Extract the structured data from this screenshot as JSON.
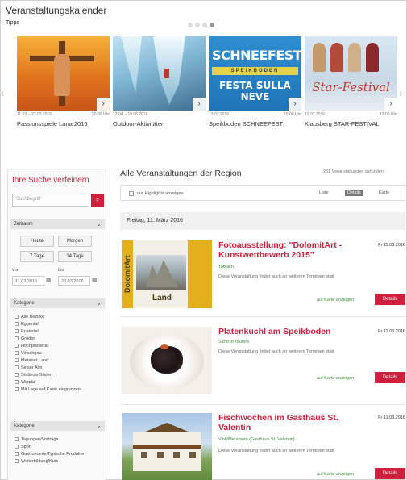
{
  "header": {
    "title": "Veranstaltungskalender",
    "tips_label": "Tipps"
  },
  "carousel": {
    "slides": [
      {
        "start": "11.03. - 23.03.2016",
        "end": "20:30 Uhr",
        "name": "Passionsspiele Lana 2016"
      },
      {
        "start": "12.04. - 18.06.2016",
        "end": "",
        "name": "Outdoor-Aktivitäten"
      },
      {
        "start": "13.03.2016",
        "end": "10:00 Uhr",
        "name": "Speikboden SCHNEEFEST",
        "art_title": "SCHNEEFEST",
        "art_subtitle": "SPEIKBODEN",
        "art_bottom": "FESTA SULLA NEVE"
      },
      {
        "start": "13.03.2016",
        "end": "12:00 Uhr",
        "name": "Klausberg STAR-FESTIVAL",
        "art_title": "Star-Festival"
      }
    ]
  },
  "sidebar": {
    "title": "Ihre Suche verfeinern",
    "search_placeholder": "Suchbegriff",
    "period_label": "Zeitraum",
    "buttons": [
      "Heute",
      "Morgen",
      "7 Tage",
      "14 Tage"
    ],
    "from_label": "von",
    "to_label": "bis",
    "from_value": "11.03.2016",
    "to_value": "25.03.2016",
    "categories_label": "Kategorie",
    "categories": [
      "Alle Bezirke",
      "Eggental",
      "Pustertal",
      "Gröden",
      "Hochpustertal",
      "Vinschgau",
      "Meraner Land",
      "Seiser Alm",
      "Südtirols Süden",
      "Wipptal",
      "Mit Lage auf Karte eingrenzen"
    ],
    "type_label": "Kategorie",
    "types": [
      "Tagungen/Vorträge",
      "Sport",
      "Gastronomie/Typische Produkte",
      "Weiterbildung/Kurs"
    ]
  },
  "main": {
    "title": "Alle Veranstaltungen der Region",
    "result_count": "281 Veranstaltungen gefunden",
    "highlight_label": "nur Highlights anzeigen",
    "view_list": "Liste",
    "view_detail": "Details",
    "view_map": "Karte",
    "date_heading": "Freitag, 11. März 2016",
    "map_link": "auf Karte anzeigen",
    "details_label": "Details",
    "events": [
      {
        "title": "Fotoausstellung: \"DolomitArt - Kunstwettbewerb 2015\"",
        "date": "Fr 11.03.2016",
        "location": "Toblach",
        "desc": "Diese Veranstaltung findet auch an weiteren Terminen statt",
        "img_text": "DolomitArt",
        "img_text2": "Land"
      },
      {
        "title": "Platenkuchl am Speikboden",
        "date": "Fr 11.03.2016",
        "location": "Sand in Taufers",
        "desc": "Diese Veranstaltung findet auch an weiteren Terminen statt"
      },
      {
        "title": "Fischwochen im Gasthaus St. Valentin",
        "date": "Fr 11.03.2016",
        "location": "Vintl/Meransen (Gasthaus St. Valentin)",
        "desc": "Diese Veranstaltung findet auch an weiteren Terminen statt"
      }
    ]
  }
}
